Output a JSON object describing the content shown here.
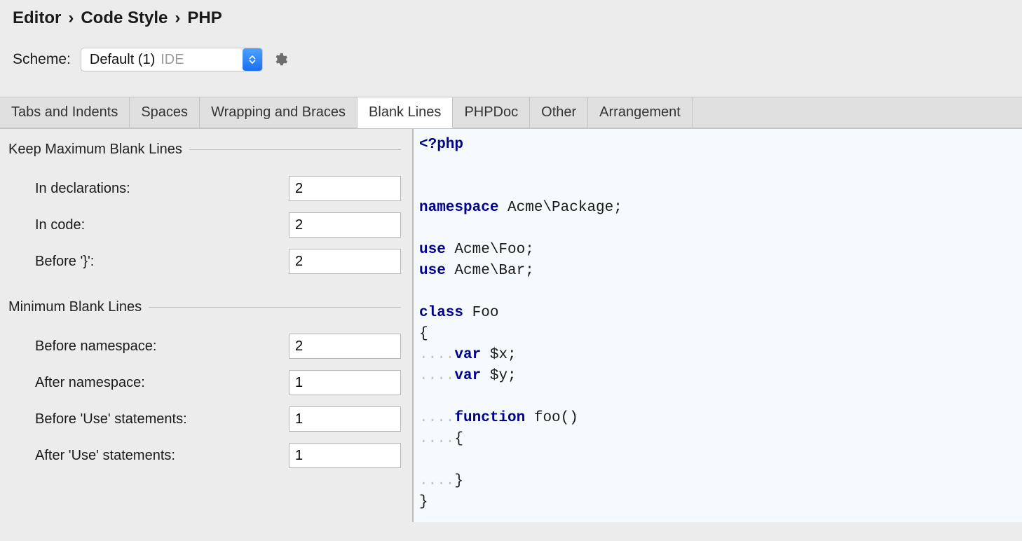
{
  "breadcrumb": {
    "p0": "Editor",
    "p1": "Code Style",
    "p2": "PHP"
  },
  "scheme": {
    "label": "Scheme:",
    "selected": "Default (1)",
    "scope": "IDE"
  },
  "tabs": {
    "tabs_and_indents": "Tabs and Indents",
    "spaces": "Spaces",
    "wrapping_and_braces": "Wrapping and Braces",
    "blank_lines": "Blank Lines",
    "phpdoc": "PHPDoc",
    "other": "Other",
    "arrangement": "Arrangement"
  },
  "sections": {
    "keep_max": {
      "title": "Keep Maximum Blank Lines",
      "in_declarations": {
        "label": "In declarations:",
        "value": "2"
      },
      "in_code": {
        "label": "In code:",
        "value": "2"
      },
      "before_close_brace": {
        "label": "Before '}':",
        "value": "2"
      }
    },
    "min": {
      "title": "Minimum Blank Lines",
      "before_namespace": {
        "label": "Before namespace:",
        "value": "2"
      },
      "after_namespace": {
        "label": "After namespace:",
        "value": "1"
      },
      "before_use": {
        "label": "Before 'Use' statements:",
        "value": "1"
      },
      "after_use": {
        "label": "After 'Use' statements:",
        "value": "1"
      }
    }
  },
  "preview": {
    "l1": "<?php",
    "l2": "",
    "l3": "",
    "l4_kw": "namespace",
    "l4_rest": " Acme\\Package;",
    "l5": "",
    "l6_kw": "use",
    "l6_rest": " Acme\\Foo;",
    "l7_kw": "use",
    "l7_rest": " Acme\\Bar;",
    "l8": "",
    "l9_kw": "class",
    "l9_rest": " Foo",
    "l10": "{",
    "l11_kw": "var",
    "l11_rest": " $x;",
    "l12_kw": "var",
    "l12_rest": " $y;",
    "l13": "",
    "l14_kw": "function",
    "l14_rest": " foo()",
    "l15": "{",
    "l16": "",
    "l17": "}",
    "l18": "}"
  }
}
